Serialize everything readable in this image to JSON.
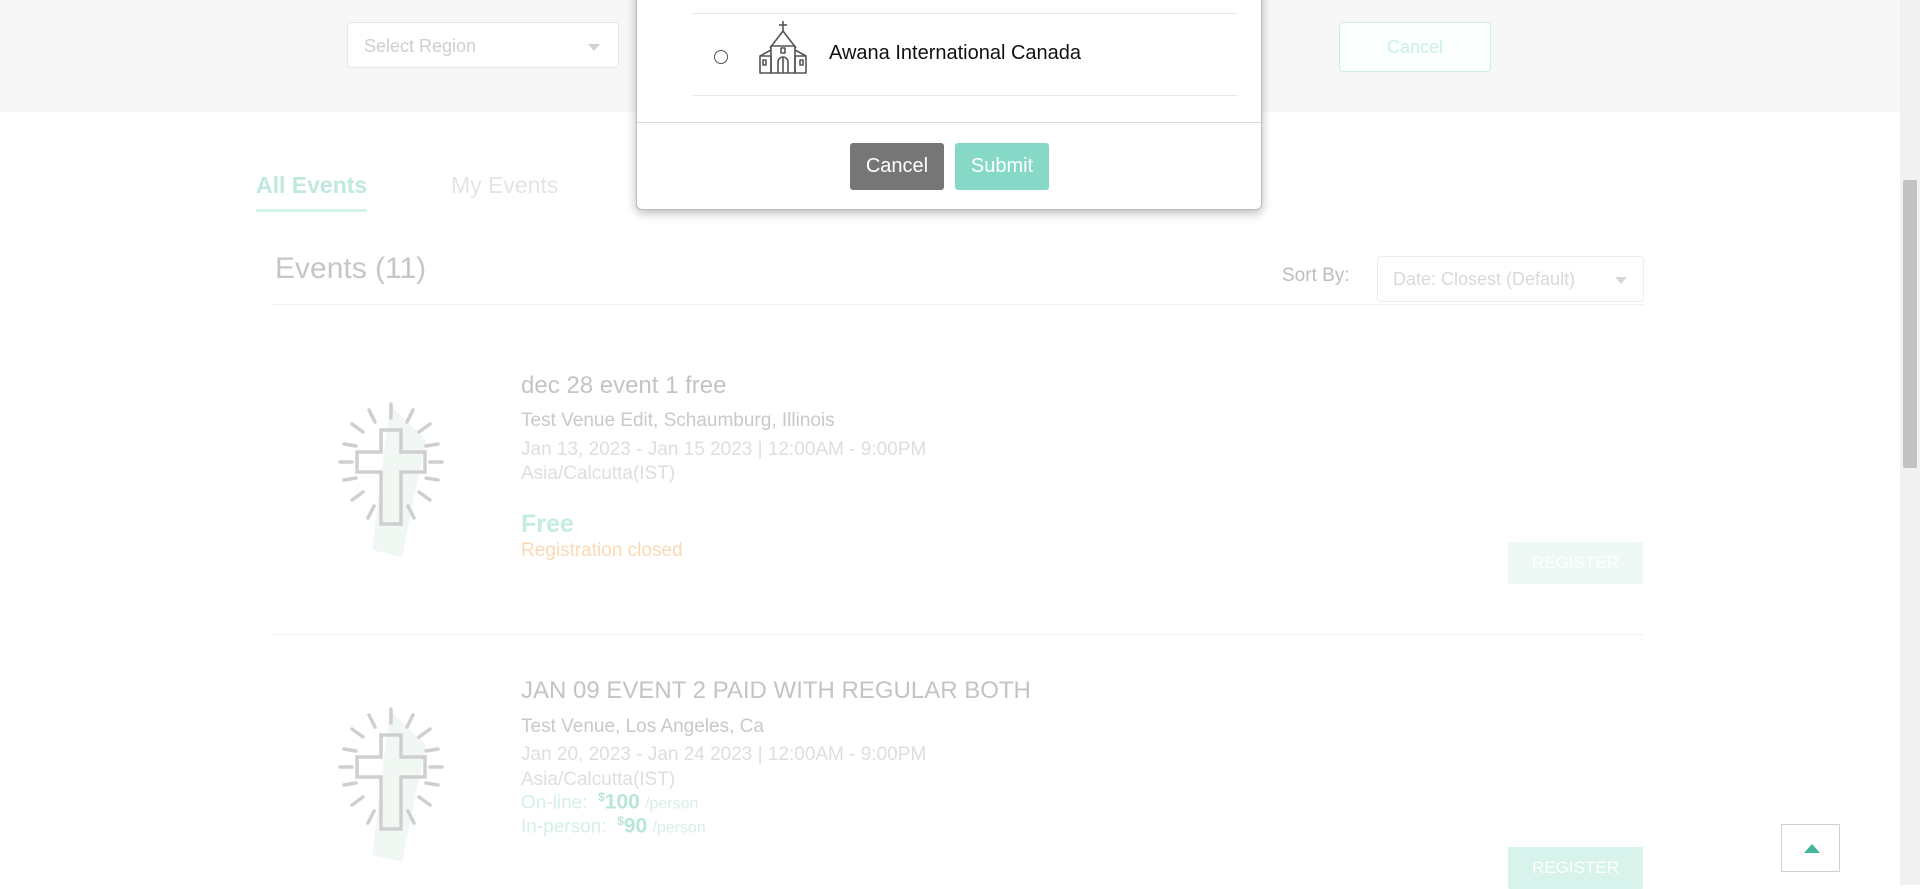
{
  "filters": {
    "region_placeholder": "Select Region",
    "cancel_label": "Cancel"
  },
  "tabs": [
    {
      "label": "All Events",
      "active": true
    },
    {
      "label": "My Events",
      "active": false
    }
  ],
  "events_header": {
    "title": "Events (11)",
    "sort_label": "Sort By:",
    "sort_value": "Date: Closest (Default)"
  },
  "events": [
    {
      "title": "dec 28 event 1 free",
      "venue": "Test Venue Edit, Schaumburg, Illinois",
      "dates": "Jan 13, 2023 - Jan 15 2023 | 12:00AM - 9:00PM",
      "timezone": "Asia/Calcutta(IST)",
      "price": "Free",
      "status": "Registration closed",
      "register_label": "REGISTER"
    },
    {
      "title": "JAN 09 EVENT 2 PAID WITH REGULAR BOTH",
      "venue": "Test Venue, Los Angeles, Ca",
      "dates": "Jan 20, 2023 - Jan 24 2023 | 12:00AM - 9:00PM",
      "timezone": "Asia/Calcutta(IST)",
      "online_label": "On-line:",
      "online_currency": "$",
      "online_amount": "100",
      "online_unit": "/person",
      "inperson_label": "In-person:",
      "inperson_currency": "$",
      "inperson_amount": "90",
      "inperson_unit": "/person",
      "register_label": "REGISTER"
    }
  ],
  "modal": {
    "organization": {
      "name": "Awana International Canada",
      "icon": "church-icon",
      "selected": false
    },
    "cancel_label": "Cancel",
    "submit_label": "Submit"
  },
  "colors": {
    "accent": "#86d9c6",
    "cancel_button": "#767676",
    "scroll_top_arrow": "#43b59a"
  }
}
